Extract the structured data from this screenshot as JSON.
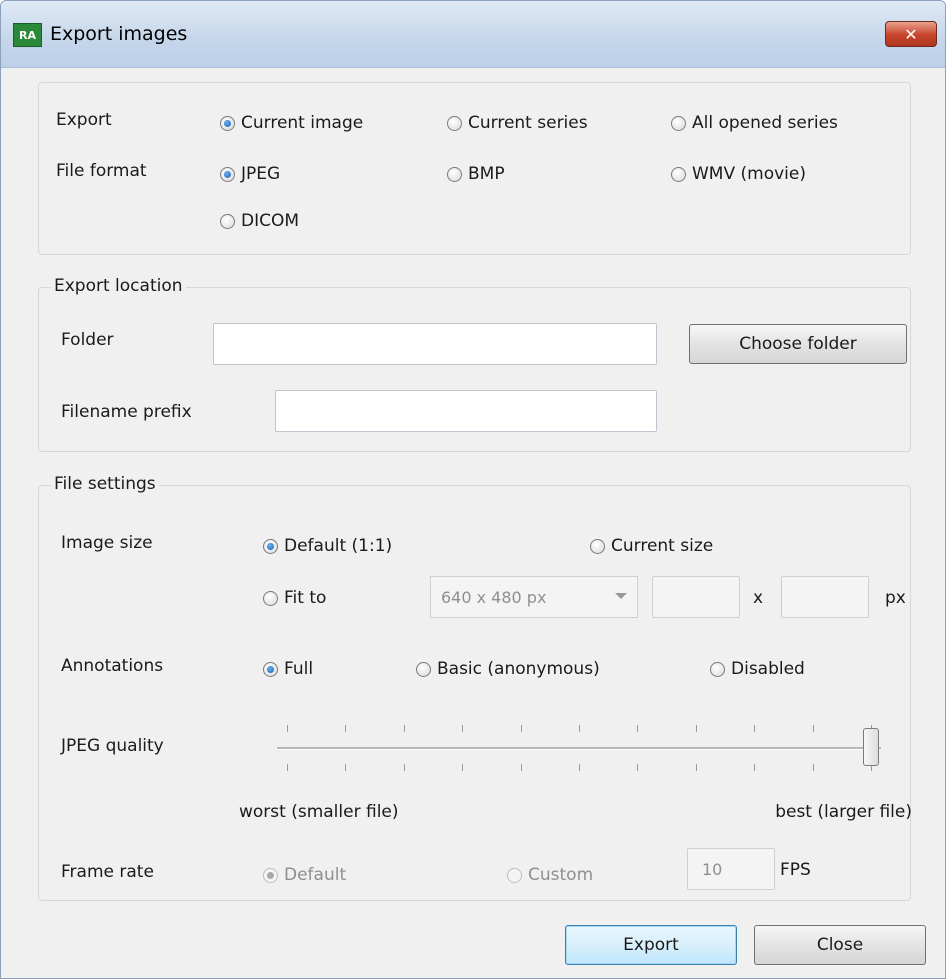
{
  "window": {
    "title": "Export images",
    "app_icon": "RA",
    "close_glyph": "✕"
  },
  "export": {
    "label": "Export",
    "options": [
      "Current image",
      "Current series",
      "All opened series"
    ],
    "selected": "Current image"
  },
  "file_format": {
    "label": "File format",
    "options": [
      "JPEG",
      "BMP",
      "WMV (movie)",
      "DICOM"
    ],
    "selected": "JPEG"
  },
  "export_location": {
    "title": "Export location",
    "folder_label": "Folder",
    "folder_value": "",
    "choose_folder_label": "Choose folder",
    "prefix_label": "Filename prefix",
    "prefix_value": ""
  },
  "file_settings": {
    "title": "File settings",
    "image_size": {
      "label": "Image size",
      "default_label": "Default (1:1)",
      "current_label": "Current size",
      "fit_label": "Fit to",
      "preset_value": "640 x 480 px",
      "width_value": "",
      "x_label": "x",
      "height_value": "",
      "px_label": "px",
      "selected": "Default (1:1)"
    },
    "annotations": {
      "label": "Annotations",
      "options": [
        "Full",
        "Basic (anonymous)",
        "Disabled"
      ],
      "selected": "Full"
    },
    "jpeg_quality": {
      "label": "JPEG quality",
      "min_label": "worst (smaller file)",
      "max_label": "best (larger file)",
      "value_fraction": 1.0
    },
    "frame_rate": {
      "label": "Frame rate",
      "default_label": "Default",
      "custom_label": "Custom",
      "fps_value": "10",
      "fps_label": "FPS",
      "selected": "Default"
    }
  },
  "buttons": {
    "export_label": "Export",
    "close_label": "Close"
  }
}
